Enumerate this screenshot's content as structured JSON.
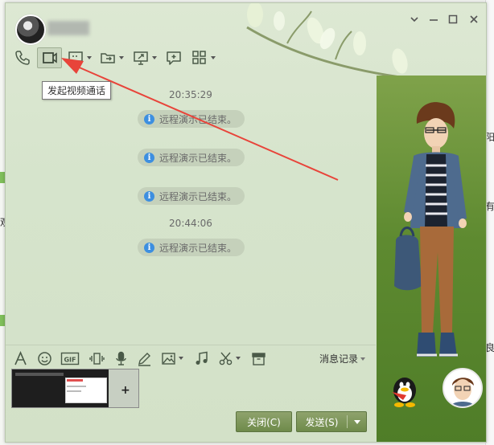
{
  "tooltip": {
    "text": "发起视频通话"
  },
  "chat": {
    "messages": [
      {
        "type": "time",
        "text": "20:35:29"
      },
      {
        "type": "system",
        "text": "远程演示已结束。"
      },
      {
        "type": "system",
        "text": "远程演示已结束。"
      },
      {
        "type": "system",
        "text": "远程演示已结束。"
      },
      {
        "type": "time",
        "text": "20:44:06"
      },
      {
        "type": "system",
        "text": "远程演示已结束。"
      }
    ]
  },
  "input_toolbar": {
    "history_label": "消息记录"
  },
  "buttons": {
    "close_label": "关闭(C)",
    "send_label": "发送(S)"
  },
  "header": {
    "contact_name": ""
  },
  "background_fragments": [
    "阳",
    "有",
    "观",
    "良"
  ],
  "colors": {
    "accent_button": "#6e8a4a",
    "annotation_arrow": "#e8443a",
    "info_icon": "#3d8fe0"
  },
  "icons": {
    "toolbar": [
      "phone-icon",
      "video-call-icon",
      "screen-share-icon",
      "file-transfer-icon",
      "remote-desktop-icon",
      "message-add-icon",
      "apps-grid-icon"
    ],
    "input": [
      "font-icon",
      "emoji-icon",
      "gif-icon",
      "shake-icon",
      "voice-icon",
      "draw-icon",
      "image-icon",
      "music-icon",
      "scissors-icon",
      "archive-icon"
    ]
  }
}
